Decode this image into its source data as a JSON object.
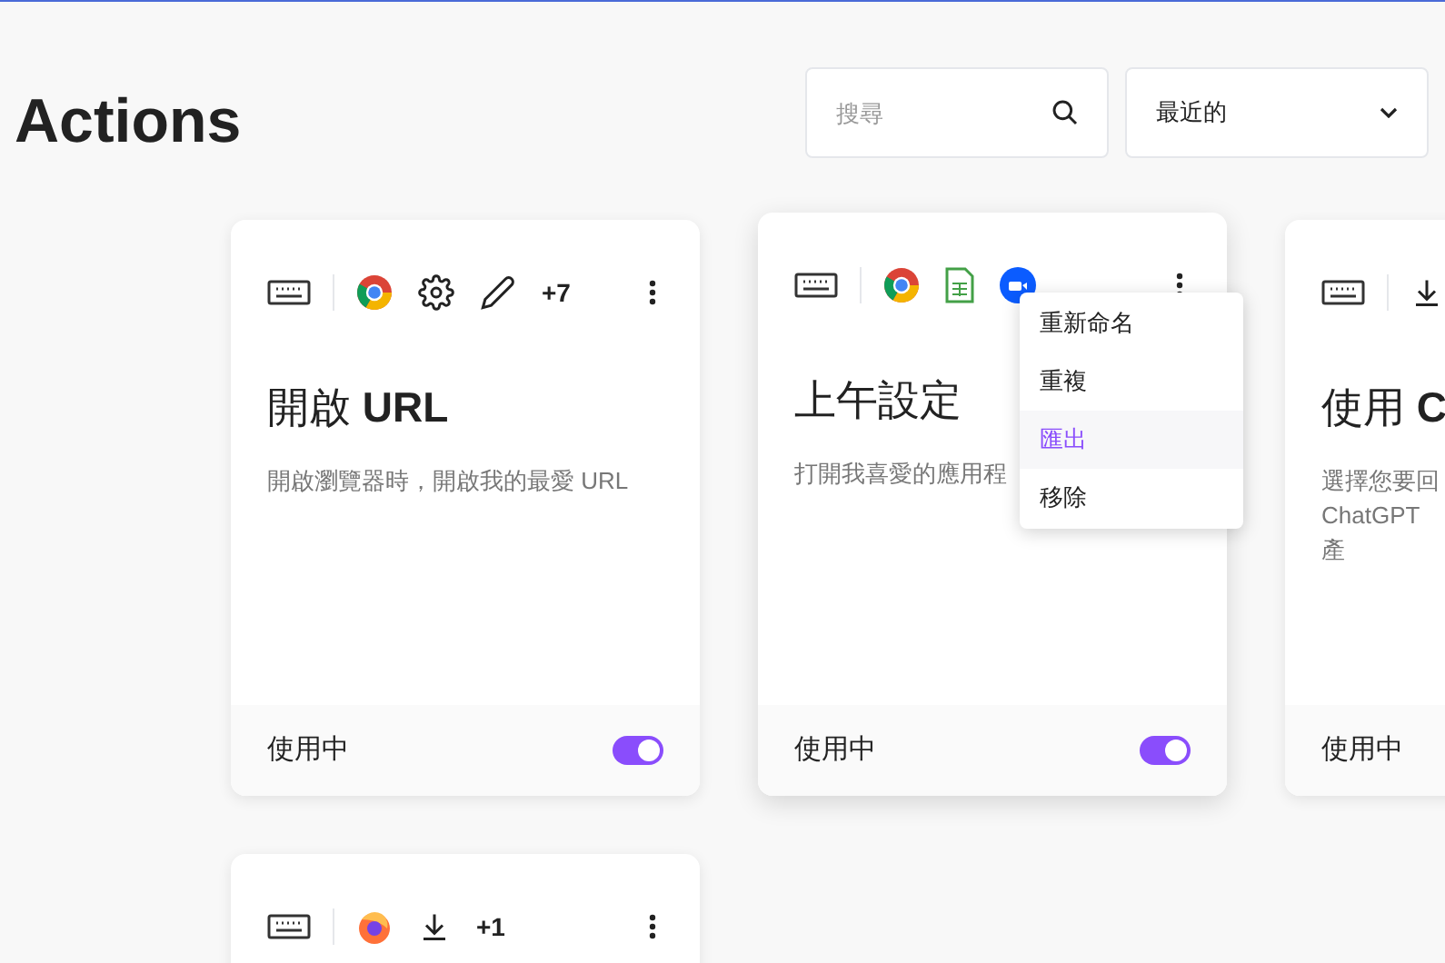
{
  "header": {
    "title": "Actions",
    "search": {
      "placeholder": "搜尋"
    },
    "sort": {
      "value": "最近的"
    }
  },
  "cards": [
    {
      "apps": [
        {
          "kind": "browser"
        },
        {
          "kind": "gear"
        },
        {
          "kind": "pencil"
        }
      ],
      "more": "+7",
      "title": "開啟 **URL**",
      "description": "開啟瀏覽器時，開啟我的最愛 URL",
      "status": "使用中",
      "on": true
    },
    {
      "apps": [
        {
          "kind": "browser"
        },
        {
          "kind": "spreadsheet"
        },
        {
          "kind": "video"
        }
      ],
      "title": "上午設定",
      "description": "打開我喜愛的應用程",
      "status": "使用中",
      "on": true,
      "menu": [
        {
          "label": "重新命名",
          "selected": false
        },
        {
          "label": "重複",
          "selected": false
        },
        {
          "label": "匯出",
          "selected": true
        },
        {
          "label": "移除",
          "selected": false
        }
      ]
    },
    {
      "apps": [
        {
          "kind": "download"
        }
      ],
      "title": "使用 **C**",
      "description": "選擇您要回ChatGPT 產",
      "status": "使用中"
    },
    {
      "apps": [
        {
          "kind": "firefox"
        },
        {
          "kind": "download"
        }
      ],
      "more": "+1"
    }
  ]
}
